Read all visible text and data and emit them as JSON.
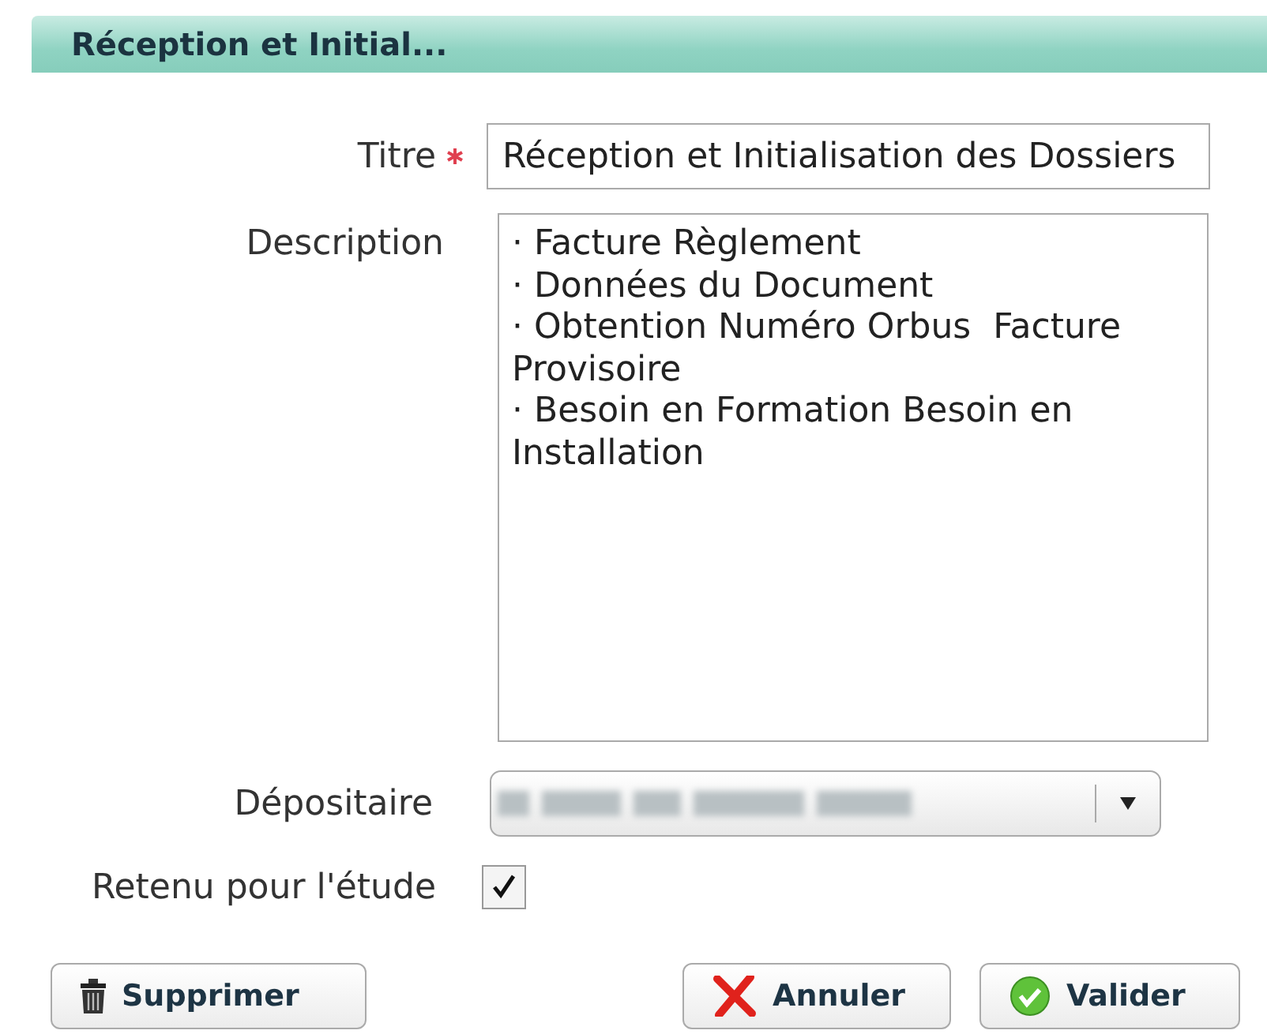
{
  "header": {
    "title": "Réception et Initial..."
  },
  "fields": [
    {
      "kind": "text",
      "label": "Titre",
      "required": true,
      "value": "Réception et Initialisation des Dossiers"
    },
    {
      "kind": "textarea",
      "label": "Description",
      "required": false,
      "value": "· Facture Règlement\n· Données du Document\n· Obtention Numéro Orbus  Facture Provisoire\n· Besoin en Formation Besoin en Installation"
    },
    {
      "kind": "select",
      "label": "Dépositaire",
      "required": false,
      "blurred": true
    },
    {
      "kind": "checkbox",
      "label": "Retenu pour l'étude",
      "required": false,
      "checked": true
    }
  ],
  "buttons": [
    {
      "kind": "delete",
      "label": "Supprimer"
    },
    {
      "kind": "cancel",
      "label": "Annuler"
    },
    {
      "kind": "confirm",
      "label": "Valider"
    }
  ]
}
